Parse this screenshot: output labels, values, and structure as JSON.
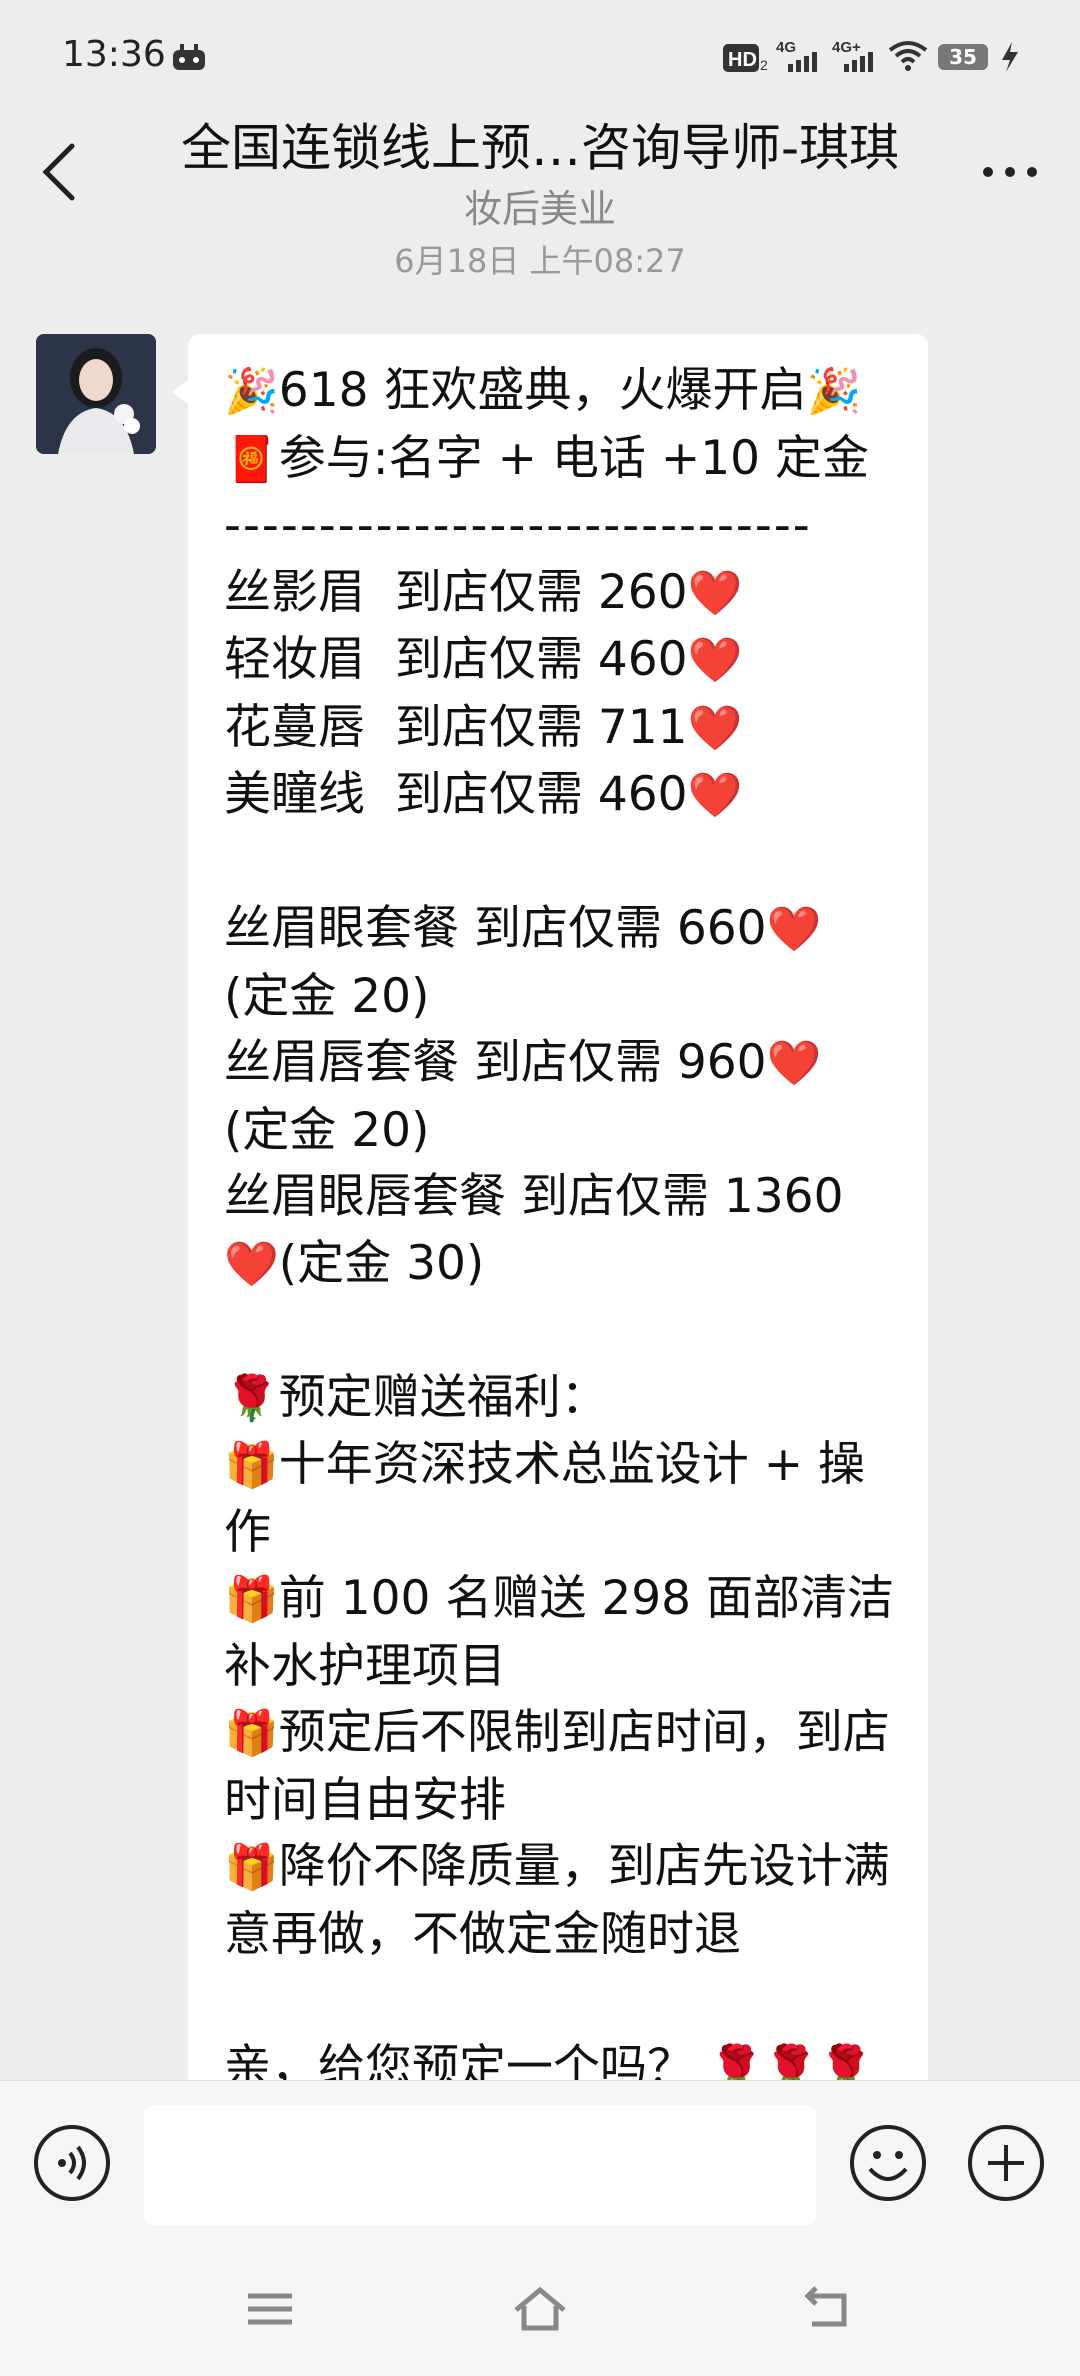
{
  "status_bar": {
    "time": "13:36",
    "battery": "35",
    "icons": [
      "game-icon",
      "hd-icon",
      "signal-4g-icon",
      "signal-4g-plus-icon",
      "wifi-icon",
      "battery-icon",
      "charging-icon"
    ]
  },
  "header": {
    "title": "全国连锁线上预…咨询导师-琪琪",
    "subtitle": "妆后美业"
  },
  "timestamp": "6月18日 上午08:27",
  "message": {
    "l1_a": "🎉",
    "l1_b": "618 狂欢盛典，火爆开启",
    "l1_c": "🎉",
    "l2_a": "🧧",
    "l2_b": "参与:名字 + 电话 +10 定金",
    "l3": "-------------------------------",
    "l4": "丝影眉  到店仅需 260",
    "l5": "轻妆眉  到店仅需 460",
    "l6": "花蔓唇  到店仅需 711",
    "l7": "美瞳线  到店仅需 460",
    "l8": "丝眉眼套餐 到店仅需 660",
    "l9": "(定金 20)",
    "l10": "丝眉唇套餐 到店仅需 960",
    "l11": "(定金 20)",
    "l12": "丝眉眼唇套餐 到店仅需 1360",
    "l13": "(定金 30)",
    "l14": "预定赠送福利：",
    "l15": "十年资深技术总监设计 + 操作",
    "l16": "前 100 名赠送 298 面部清洁补水护理项目",
    "l17": "预定后不限制到店时间，到店时间自由安排",
    "l18": "降价不降质量，到店先设计满意再做，不做定金随时退",
    "l19": "亲，给您预定一个吗？",
    "heart": "❤️",
    "rose": "🌹",
    "gift": "🎁"
  },
  "input_bar": {
    "voice_icon": "voice-icon",
    "emoji_icon": "emoji-icon",
    "plus_icon": "plus-icon"
  },
  "nav_bar": {
    "icons": [
      "menu-icon",
      "home-icon",
      "back-nav-icon"
    ]
  }
}
